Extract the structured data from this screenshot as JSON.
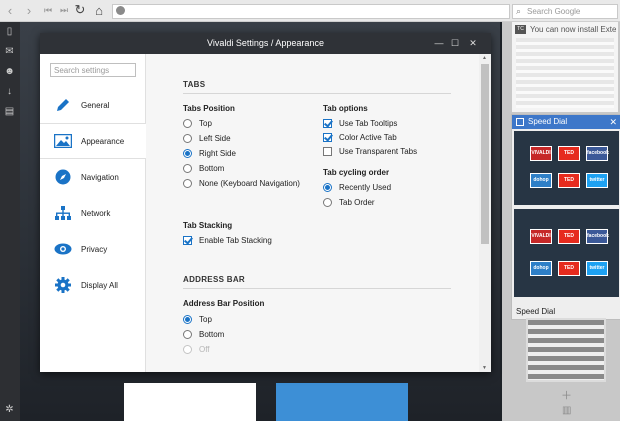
{
  "browser": {
    "search_placeholder": "Search Google",
    "icons": [
      "back-icon",
      "forward-icon",
      "rewind-icon",
      "fast-forward-icon",
      "reload-icon",
      "home-icon",
      "site-info-icon",
      "search-engine-icon"
    ]
  },
  "tab_previews": {
    "top_title": "You can now install Extens",
    "top_favicon": "TC",
    "speed_dial_title": "Speed Dial",
    "speed_dial_footer": "Speed Dial",
    "tiles": [
      "VIVALDI",
      "TED",
      "facebook",
      "dohop",
      "TED",
      "twitter"
    ]
  },
  "settings": {
    "window_title": "Vivaldi Settings / Appearance",
    "search_placeholder": "Search settings",
    "sidebar": [
      {
        "label": "General",
        "icon": "pencil-icon"
      },
      {
        "label": "Appearance",
        "icon": "image-icon"
      },
      {
        "label": "Navigation",
        "icon": "compass-icon"
      },
      {
        "label": "Network",
        "icon": "network-icon"
      },
      {
        "label": "Privacy",
        "icon": "eye-icon"
      },
      {
        "label": "Display All",
        "icon": "gear-icon"
      }
    ],
    "active_item": "Appearance",
    "tabs_section": "TABS",
    "tab_position": {
      "title": "Tabs Position",
      "options": [
        "Top",
        "Left Side",
        "Right Side",
        "Bottom",
        "None (Keyboard Navigation)"
      ],
      "selected": "Right Side"
    },
    "tab_options": {
      "title": "Tab options",
      "options": [
        {
          "label": "Use Tab Tooltips",
          "checked": true
        },
        {
          "label": "Color Active Tab",
          "checked": true
        },
        {
          "label": "Use Transparent Tabs",
          "checked": false
        }
      ]
    },
    "tab_cycling": {
      "title": "Tab cycling order",
      "options": [
        "Recently Used",
        "Tab Order"
      ],
      "selected": "Recently Used"
    },
    "tab_stacking": {
      "title": "Tab Stacking",
      "option": "Enable Tab Stacking",
      "checked": true
    },
    "address_section": "ADDRESS BAR",
    "address_position": {
      "title": "Address Bar Position",
      "options": [
        "Top",
        "Bottom",
        "Off"
      ],
      "selected": "Top"
    }
  },
  "colors": {
    "accent": "#1a73c6",
    "titlebar": "#2f3237",
    "speed_dial_header": "#3d77c9"
  }
}
